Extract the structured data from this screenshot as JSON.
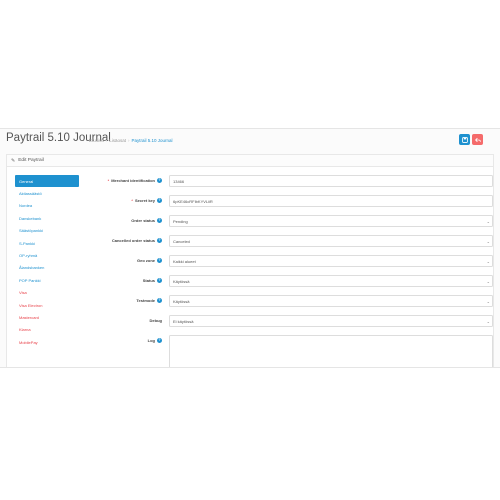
{
  "header": {
    "title": "Paytrail 5.10 Journal",
    "breadcrumb": [
      "Etusivu",
      "Lisäosat",
      "Paytrail 5.10 Journal"
    ],
    "save_icon": "save-icon",
    "cancel_icon": "reply-icon"
  },
  "panel": {
    "heading": "Edit Paytrail",
    "heading_icon": "pencil-icon"
  },
  "nav": {
    "items": [
      {
        "label": "General",
        "active": true,
        "color": "#1e91cf"
      },
      {
        "label": "Aktiassäästö",
        "color": "#1e91cf"
      },
      {
        "label": "Nordea",
        "color": "#1e91cf"
      },
      {
        "label": "Danskebank",
        "color": "#1e91cf"
      },
      {
        "label": "Säästöpankki",
        "color": "#1e91cf"
      },
      {
        "label": "S-Pankki",
        "color": "#1e91cf"
      },
      {
        "label": "OP-ryhmä",
        "color": "#1e91cf"
      },
      {
        "label": "Ålandsbanken",
        "color": "#1e91cf"
      },
      {
        "label": "POP Pankki",
        "color": "#1e91cf"
      },
      {
        "label": "Visa",
        "color": "#e8424a"
      },
      {
        "label": "Visa Electron",
        "color": "#e8424a"
      },
      {
        "label": "Mastercard",
        "color": "#e8424a"
      },
      {
        "label": "Klarna",
        "color": "#e8424a"
      },
      {
        "label": "MobilePay",
        "color": "#e8424a"
      }
    ]
  },
  "form": {
    "merchant_id": {
      "label": "Merchant identification",
      "required": true,
      "value": "13466"
    },
    "secret_key": {
      "label": "Secret key",
      "required": true,
      "value": "6pKE46cRFIbKYVLiiR"
    },
    "order_status": {
      "label": "Order status",
      "value": "Pending"
    },
    "cancelled_order_status": {
      "label": "Cancelled order status",
      "value": "Canceled"
    },
    "geo_zone": {
      "label": "Geo zone",
      "value": "Kaikki alueet"
    },
    "status": {
      "label": "Status",
      "value": "Käytössä"
    },
    "testmode": {
      "label": "Testmode",
      "value": "Käytössä"
    },
    "debug": {
      "label": "Debug",
      "value": "Ei käytössä"
    },
    "log": {
      "label": "Log",
      "value": ""
    }
  },
  "colors": {
    "accent": "#1e91cf",
    "danger": "#f56b6b",
    "red_link": "#e8424a"
  }
}
